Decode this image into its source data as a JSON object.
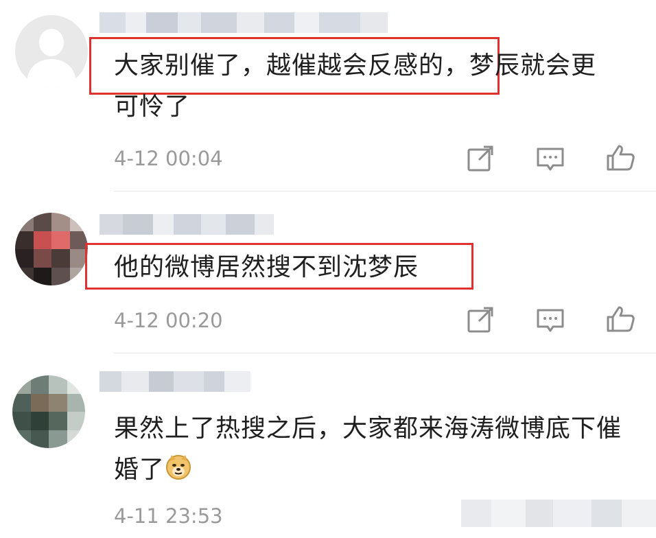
{
  "comments": [
    {
      "text_highlighted": "大家别催了，越催越会反感的，",
      "text_rest": "梦辰就会更可怜了",
      "time": "4-12 00:04",
      "actions": [
        "share-icon",
        "comment-icon",
        "like-icon"
      ]
    },
    {
      "text_highlighted": "他的微博居然搜不到沈梦辰",
      "text_rest": "",
      "time": "4-12 00:20",
      "actions": [
        "share-icon",
        "comment-icon",
        "like-icon"
      ]
    },
    {
      "text_highlighted": "",
      "text_rest": "果然上了热搜之后，大家都来海涛微博底下催婚了",
      "emoji": "doge-emoji",
      "time": "4-11 23:53",
      "actions": []
    }
  ],
  "colors": {
    "highlight": "#e03030",
    "timestamp": "#9a9a9a",
    "icon": "#8c8c8c"
  }
}
